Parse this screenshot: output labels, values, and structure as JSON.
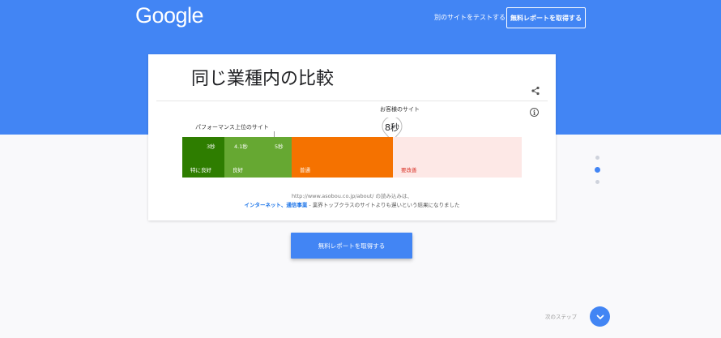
{
  "header": {
    "logo": "Google",
    "test_other_site": "別のサイトをテストする",
    "get_report": "無料レポートを取得する"
  },
  "card": {
    "title": "同じ業種内の比較",
    "customer_label": "お客様のサイト",
    "customer_value": "8秒",
    "top_sites_label": "パフォーマンス上位のサイト",
    "segments": [
      {
        "label": "特に良好",
        "value": "3秒"
      },
      {
        "label": "良好",
        "value_start": "4.1秒",
        "value_end": "5秒"
      },
      {
        "label": "普通"
      },
      {
        "label": "要改善"
      }
    ],
    "description_url": "http://www.asobou.co.jp/about/ の読み込みは、",
    "description_industry": "インターネット、通信事業",
    "description_rest": " - 業界トップクラスのサイトよりも遅いという結果になりました"
  },
  "cta": {
    "label": "無料レポートを取得する"
  },
  "pagination": {
    "count": 3,
    "active_index": 1
  },
  "next_step": {
    "label": "次のステップ"
  },
  "colors": {
    "primary": "#4285f4",
    "excellent": "#2e7d00",
    "good": "#66a832",
    "average": "#f57200",
    "needs_improvement_bg": "#fde8e6",
    "needs_improvement_text": "#d93025"
  },
  "icons": [
    "share-icon",
    "info-icon",
    "map-pin-icon",
    "chevron-down-icon"
  ]
}
